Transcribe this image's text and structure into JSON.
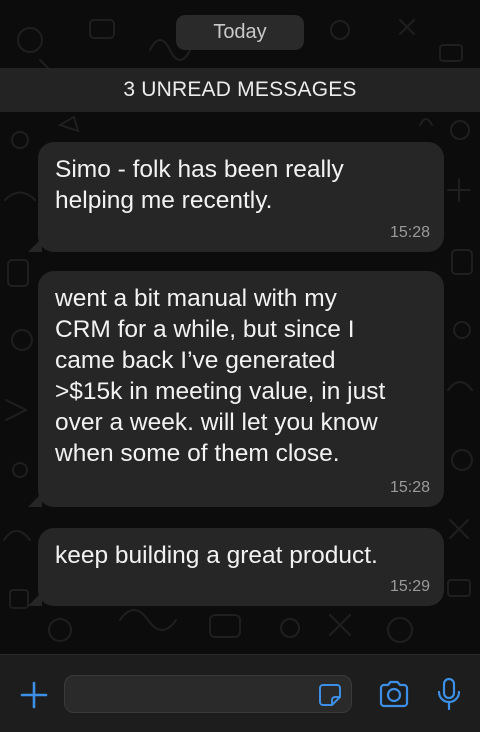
{
  "date_chip": "Today",
  "unread_banner": "3 UNREAD MESSAGES",
  "messages": [
    {
      "text": "Simo - folk has been really\nhelping me recently.",
      "time": "15:28"
    },
    {
      "text": "went a bit manual with my\nCRM for a while, but since I\ncame back I’ve generated\n>$15k in meeting value, in just\nover a week. will let you know\nwhen some of them close.",
      "time": "15:28"
    },
    {
      "text": "keep building a great product.",
      "time": "15:29"
    }
  ],
  "composer": {
    "input_value": "",
    "icons": [
      "plus-icon",
      "sticker-icon",
      "camera-icon",
      "microphone-icon"
    ]
  },
  "colors": {
    "background": "#0c0c0c",
    "bubble": "#262626",
    "accent": "#3d8fe6",
    "text": "#f2f2f2",
    "timestamp": "#9a9a9a"
  }
}
